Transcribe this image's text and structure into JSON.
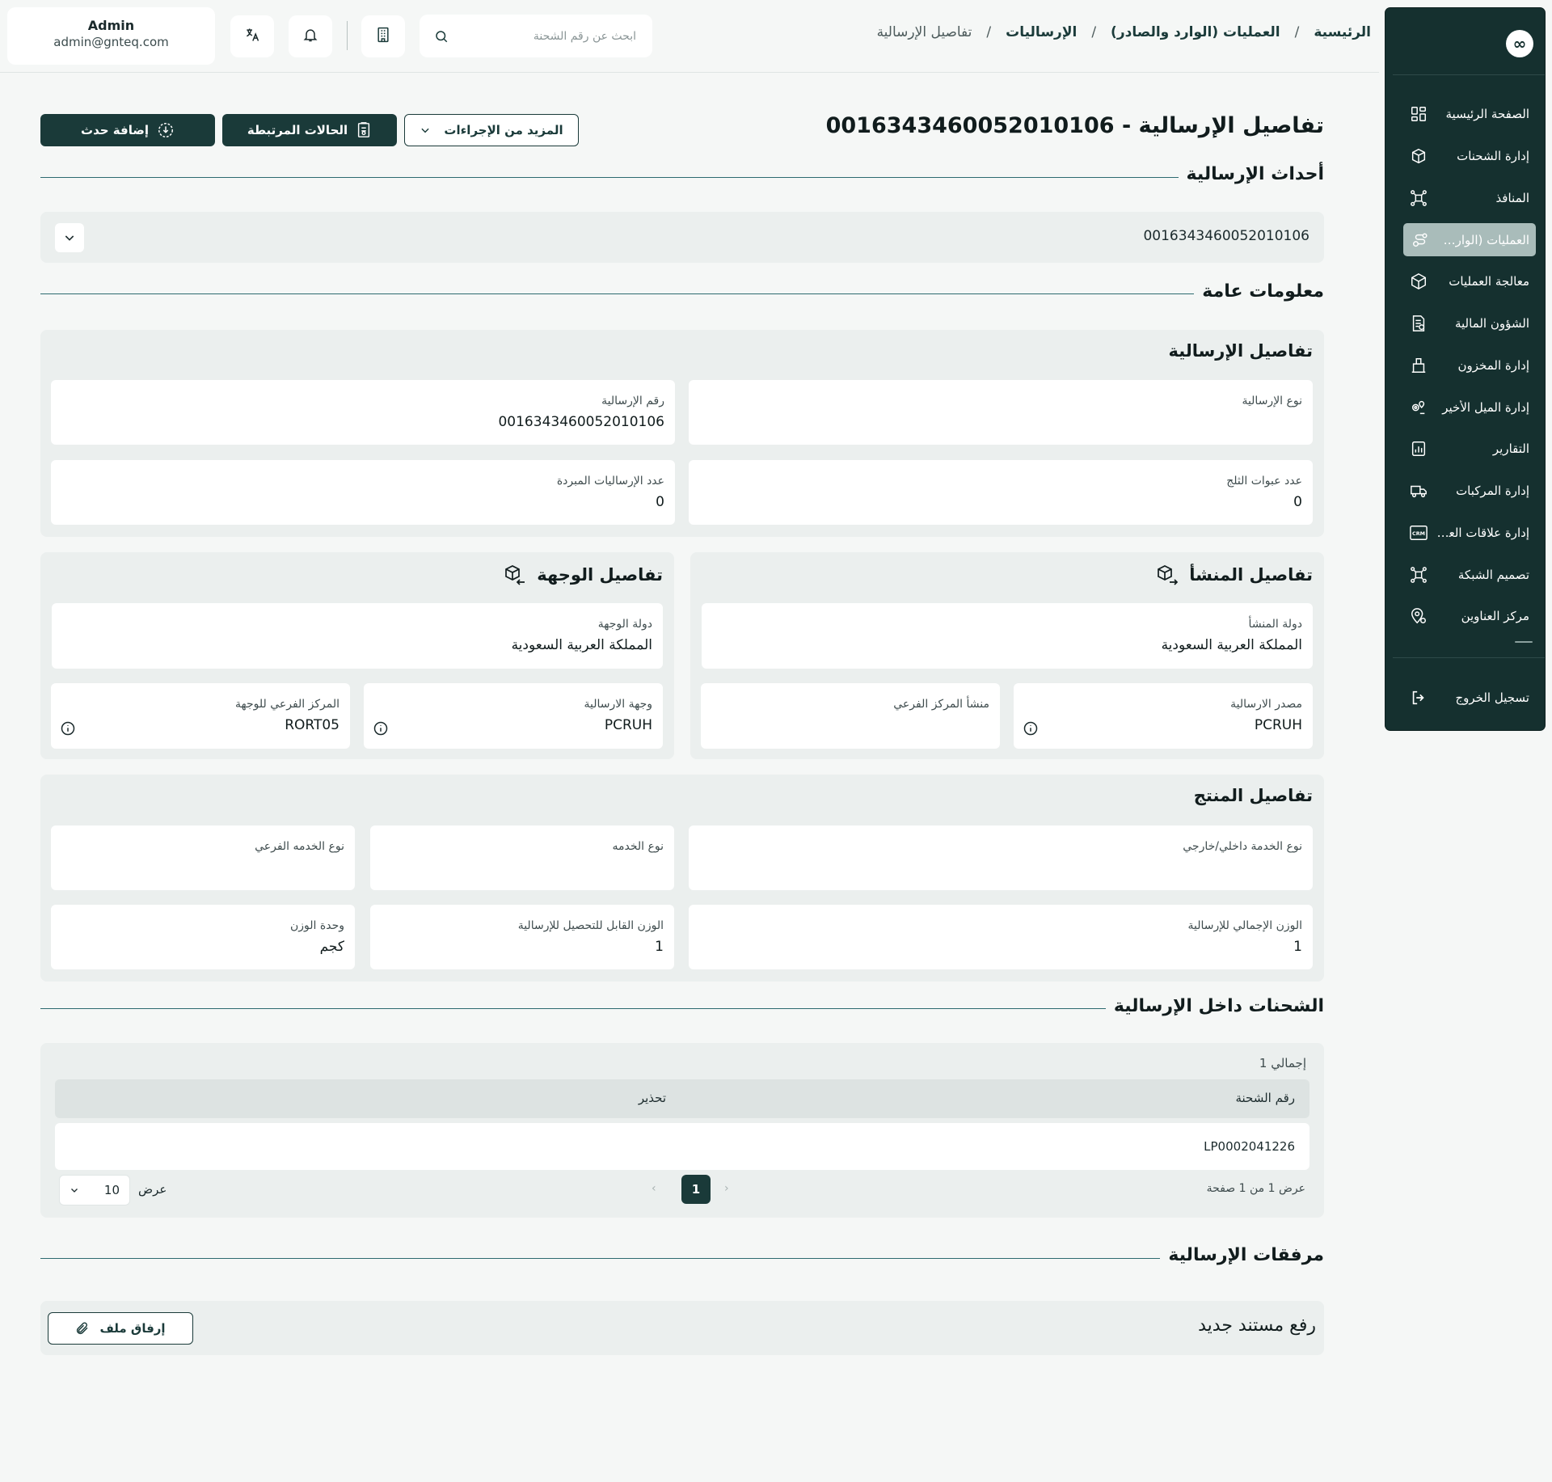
{
  "user": {
    "name": "Admin",
    "email": "admin@gnteq.com"
  },
  "search": {
    "placeholder": "ابحث عن رقم الشحنة"
  },
  "breadcrumb": {
    "home": "الرئيسية",
    "operations": "العمليات (الوارد والصادر)",
    "consignments": "الإرساليات",
    "current": "تفاصيل الإرسالية",
    "sep": "/"
  },
  "sidebar": {
    "logo": "∞",
    "items": [
      {
        "label": "الصفحة الرئيسية",
        "icon": "dashboard-icon"
      },
      {
        "label": "إدارة الشحنات",
        "icon": "box-icon"
      },
      {
        "label": "المنافذ",
        "icon": "network-icon"
      },
      {
        "label": "العمليات (الوارد والصادر)",
        "icon": "route-icon"
      },
      {
        "label": "معالجة العمليات",
        "icon": "cube-icon"
      },
      {
        "label": "الشؤون المالية",
        "icon": "finance-doc-icon"
      },
      {
        "label": "إدارة المخزون",
        "icon": "inventory-icon"
      },
      {
        "label": "إدارة الميل الأخير",
        "icon": "last-mile-icon"
      },
      {
        "label": "التقارير",
        "icon": "reports-icon"
      },
      {
        "label": "إدارة المركبات",
        "icon": "truck-icon"
      },
      {
        "label": "إدارة علاقات العملاء",
        "icon": "crm-icon"
      },
      {
        "label": "تصميم الشبكة",
        "icon": "network-design-icon"
      },
      {
        "label": "مركز العناوين",
        "icon": "location-icon"
      }
    ],
    "logout": "تسجيل الخروج"
  },
  "page": {
    "title": "تفاصيل الإرسالية - 0016343460052010106",
    "buttons": {
      "add_event": "إضافة حدث",
      "related_cases": "الحالات المرتبطة",
      "more_actions": "المزيد من الإجراءات"
    }
  },
  "events": {
    "heading": "أحداث الإرسالية",
    "number": "0016343460052010106"
  },
  "general": {
    "heading": "معلومات عامة",
    "consignment": {
      "title": "تفاصيل الإرسالية",
      "number_label": "رقم الإرسالية",
      "number_value": "0016343460052010106",
      "type_label": "نوع الإرسالية",
      "type_value": "",
      "cooled_label": "عدد الإرساليات المبردة",
      "cooled_value": "0",
      "ice_label": "عدد عبوات الثلج",
      "ice_value": "0"
    },
    "origin": {
      "title": "تفاصيل المنشأ",
      "country_label": "دولة المنشأ",
      "country_value": "المملكة العربية السعودية",
      "source_label": "مصدر الارسالية",
      "source_value": "PCRUH",
      "branch_label": "منشأ المركز الفرعي",
      "branch_value": ""
    },
    "destination": {
      "title": "تفاصيل الوجهة",
      "country_label": "دولة الوجهة",
      "country_value": "المملكة العربية السعودية",
      "dest_label": "وجهة الارسالية",
      "dest_value": "PCRUH",
      "branch_label": "المركز الفرعي للوجهة",
      "branch_value": "RORT05"
    },
    "product": {
      "title": "تفاصيل المنتج",
      "scope_label": "نوع الخدمة داخلي/خارجي",
      "scope_value": "",
      "service_label": "نوع الخدمه",
      "service_value": "",
      "subservice_label": "نوع الخدمه الفرعي",
      "subservice_value": "",
      "gross_label": "الوزن الإجمالي للإرسالية",
      "gross_value": "1",
      "charge_label": "الوزن القابل للتحصيل للإرسالية",
      "charge_value": "1",
      "unit_label": "وحدة الوزن",
      "unit_value": "كجم"
    }
  },
  "shipments": {
    "heading": "الشحنات داخل الإرسالية",
    "total": "إجمالي 1",
    "columns": [
      "رقم الشحنة",
      "تحذير"
    ],
    "rows": [
      [
        "LP0002041226",
        ""
      ]
    ],
    "summary": "عرض 1 من 1 صفحة",
    "current_page": "1",
    "per_page_label": "عرض",
    "per_page": "10"
  },
  "attachments": {
    "heading": "مرفقات الإرسالية",
    "upload_label": "رفع مستند جديد",
    "attach_button": "إرفاق ملف"
  },
  "colors": {
    "primary": "#1a3a39",
    "sidebar": "#15302f",
    "panel": "#ebefee",
    "page": "#f5f7f6"
  }
}
